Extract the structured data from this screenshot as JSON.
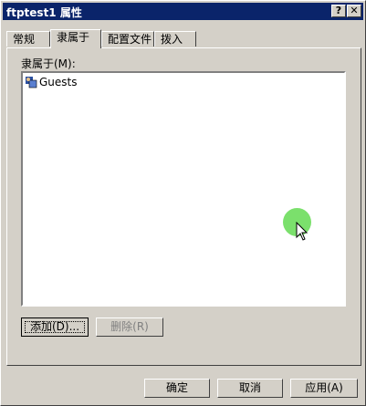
{
  "window": {
    "title": "ftptest1 属性",
    "help_button": "?",
    "close_button": "✕"
  },
  "tabs": [
    {
      "label": "常规"
    },
    {
      "label": "隶属于"
    },
    {
      "label": "配置文件"
    },
    {
      "label": "拨入"
    }
  ],
  "member_of": {
    "label": "隶属于(M):",
    "items": [
      {
        "label": "Guests",
        "icon": "group-icon"
      }
    ]
  },
  "buttons": {
    "add": "添加(D)...",
    "remove": "删除(R)",
    "ok": "确定",
    "cancel": "取消",
    "apply": "应用(A)"
  }
}
